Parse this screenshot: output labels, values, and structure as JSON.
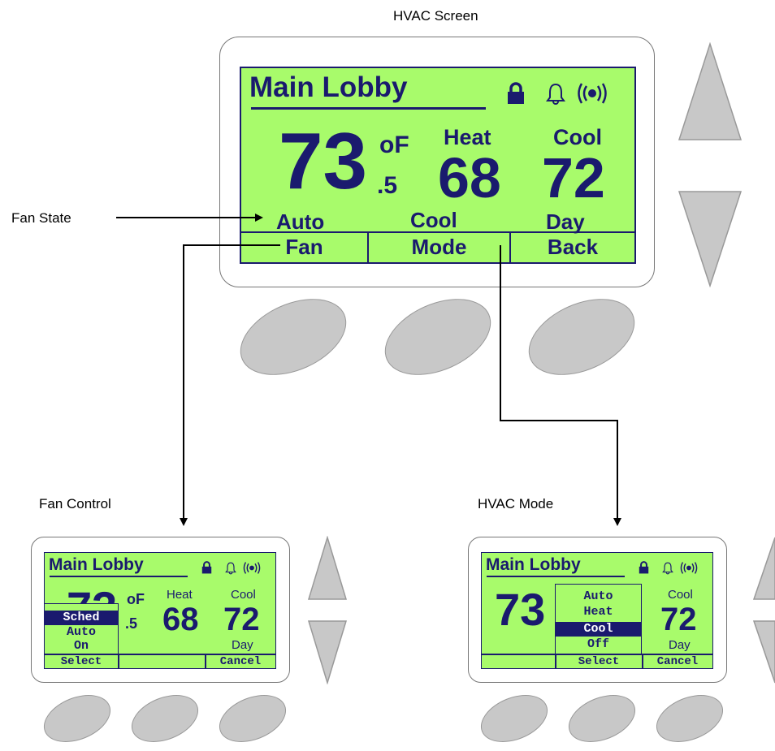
{
  "captions": {
    "hvac_screen": "HVAC Screen",
    "fan_state": "Fan State",
    "fan_control": "Fan Control",
    "hvac_mode": "HVAC Mode"
  },
  "colors": {
    "lcd": "#a8fb6b",
    "ink": "#1a1a6e",
    "button": "#c8c8c8"
  },
  "main": {
    "title": "Main Lobby",
    "temp": "73",
    "temp_unit": "oF",
    "temp_decimal": ".5",
    "heat_label": "Heat",
    "heat_value": "68",
    "cool_label": "Cool",
    "cool_value": "72",
    "fan_state": "Auto",
    "mode_state": "Cool",
    "schedule_state": "Day",
    "softkeys": [
      "Fan",
      "Mode",
      "Back"
    ],
    "icons": [
      "lock-icon",
      "bell-icon",
      "wireless-icon"
    ]
  },
  "fan_control": {
    "title": "Main Lobby",
    "temp": "73",
    "temp_unit": "oF",
    "temp_decimal": ".5",
    "heat_label": "Heat",
    "heat_value": "68",
    "cool_label": "Cool",
    "cool_value": "72",
    "schedule_state": "Day",
    "menu": [
      "Sched",
      "Auto",
      "On"
    ],
    "menu_selected": "Sched",
    "softkeys": [
      "Select",
      "",
      "Cancel"
    ]
  },
  "hvac_mode": {
    "title": "Main Lobby",
    "temp": "73",
    "cool_label": "Cool",
    "cool_value": "72",
    "schedule_state": "Day",
    "menu": [
      "Auto",
      "Heat",
      "Cool",
      "Off"
    ],
    "menu_selected": "Cool",
    "softkeys": [
      "",
      "Select",
      "Cancel"
    ]
  }
}
